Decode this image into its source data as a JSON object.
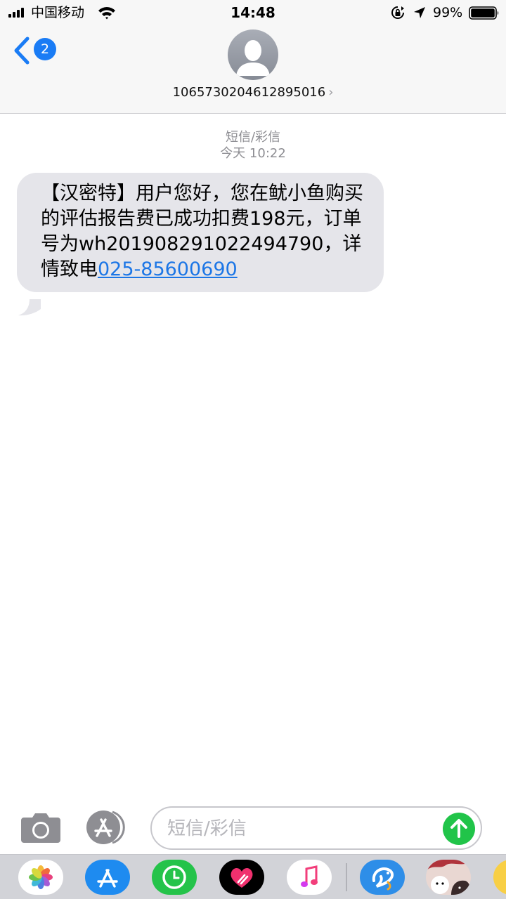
{
  "status_bar": {
    "carrier": "中国移动",
    "time": "14:48",
    "battery": "99%"
  },
  "nav": {
    "back_badge": "2",
    "contact": "1065730204612895016",
    "chevron": "›"
  },
  "thread": {
    "message_type": "短信/彩信",
    "timestamp": "今天 10:22"
  },
  "message": {
    "text": "【汉密特】用户您好，您在鱿小鱼购买的评估报告费已成功扣费198元，订单号为wh201908291022494790，详情致电",
    "phone": "025-85600690"
  },
  "input": {
    "placeholder": "短信/彩信"
  },
  "colors": {
    "accent": "#1a7cf5",
    "bubble": "#e5e5ea",
    "send": "#21c449",
    "link": "#1c76e6"
  },
  "icons": {
    "status": [
      "signal-icon",
      "wifi-icon",
      "rotation-lock-icon",
      "location-arrow-icon",
      "battery-icon"
    ],
    "drawer": [
      "photos-app-icon",
      "app-store-icon",
      "activity-app-icon",
      "digital-touch-icon",
      "music-app-icon",
      "dolphin-app-icon",
      "sticker-app-icon"
    ]
  }
}
